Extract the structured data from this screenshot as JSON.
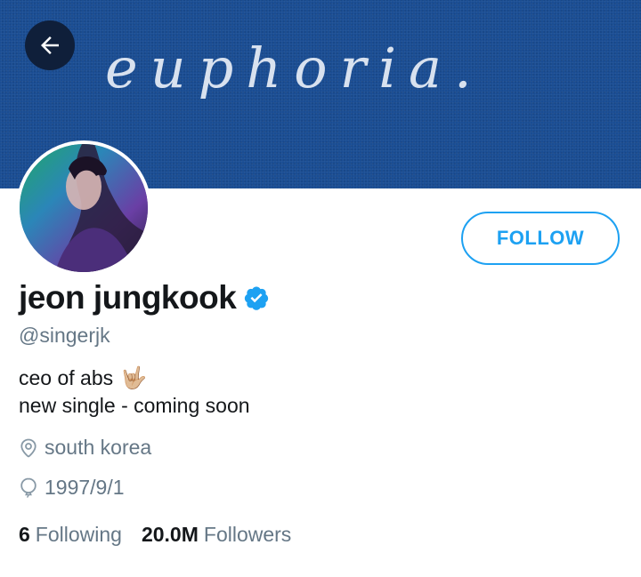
{
  "header": {
    "banner_text": "euphoria.",
    "back_icon": "arrow-left-icon"
  },
  "profile": {
    "display_name": "jeon jungkook",
    "verified": true,
    "handle": "@singerjk",
    "follow_label": "FOLLOW",
    "bio_line1": "ceo of abs",
    "bio_emoji": "🤟🏼",
    "bio_line2": "new single - coming soon",
    "location": "south korea",
    "birthday": "1997/9/1",
    "following_count": "6",
    "following_label": "Following",
    "followers_count": "20.0M",
    "followers_label": "Followers"
  },
  "colors": {
    "accent": "#1da1f2",
    "banner": "#1a4d93",
    "text_primary": "#14171a",
    "text_secondary": "#657786"
  }
}
